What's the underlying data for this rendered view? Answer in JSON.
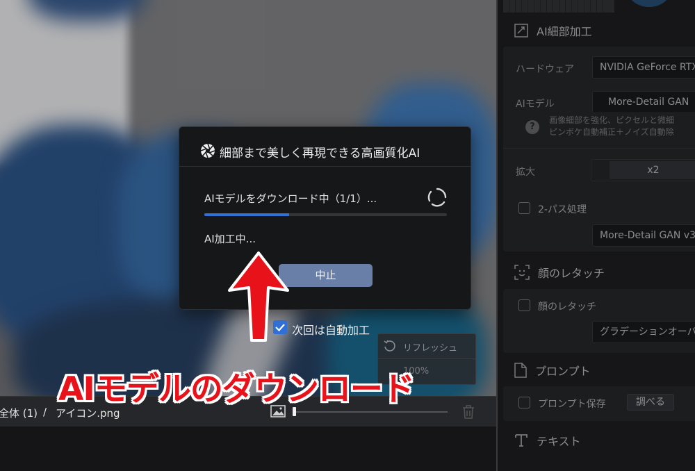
{
  "dialog": {
    "title": "細部まで美しく再現できる高画質化AI",
    "status_text": "AIモデルをダウンロード中（1/1）...",
    "progress": 0.35,
    "process_text": "AI加工中...",
    "stop_label": "中止",
    "logo_icon": "aperture-icon"
  },
  "auto_process": {
    "label": "次回は自動加工",
    "checked": true
  },
  "mini_box": {
    "refresh_label": "リフレッシュ",
    "zoom_label": "100%"
  },
  "bottom_bar": {
    "crumb_all": "全体 (1)",
    "crumb_sep": "/",
    "crumb_file": "アイコン.png"
  },
  "right_panel": {
    "ai_detail": {
      "title": "AI細部加工",
      "hardware_label": "ハードウェア",
      "hardware_value": "NVIDIA GeForce RTX",
      "model_label": "AIモデル",
      "model_value": "More-Detail GAN",
      "help_line1": "画像細部を強化、ピクセルと微細",
      "help_line2": "ピンボケ自動補正＋ノイズ自動除",
      "scale_label": "拡大",
      "scale_value": "x2",
      "twopass_label": "2-パス処理",
      "twopass_model": "More-Detail GAN  v3"
    },
    "face": {
      "title": "顔のレタッチ",
      "checkbox_label": "顔のレタッチ",
      "dropdown_value": "グラデーションオーバーレイ"
    },
    "prompt": {
      "title": "プロンプト",
      "save_label": "プロンプト保存",
      "lookup_button": "調べる"
    },
    "text_section": {
      "title": "テキスト"
    }
  },
  "annotation": {
    "text": "AIモデルのダウンロード",
    "color": "#e8131a"
  },
  "colors": {
    "accent": "#2f6fd6",
    "stop_button": "#6a7fa8"
  }
}
